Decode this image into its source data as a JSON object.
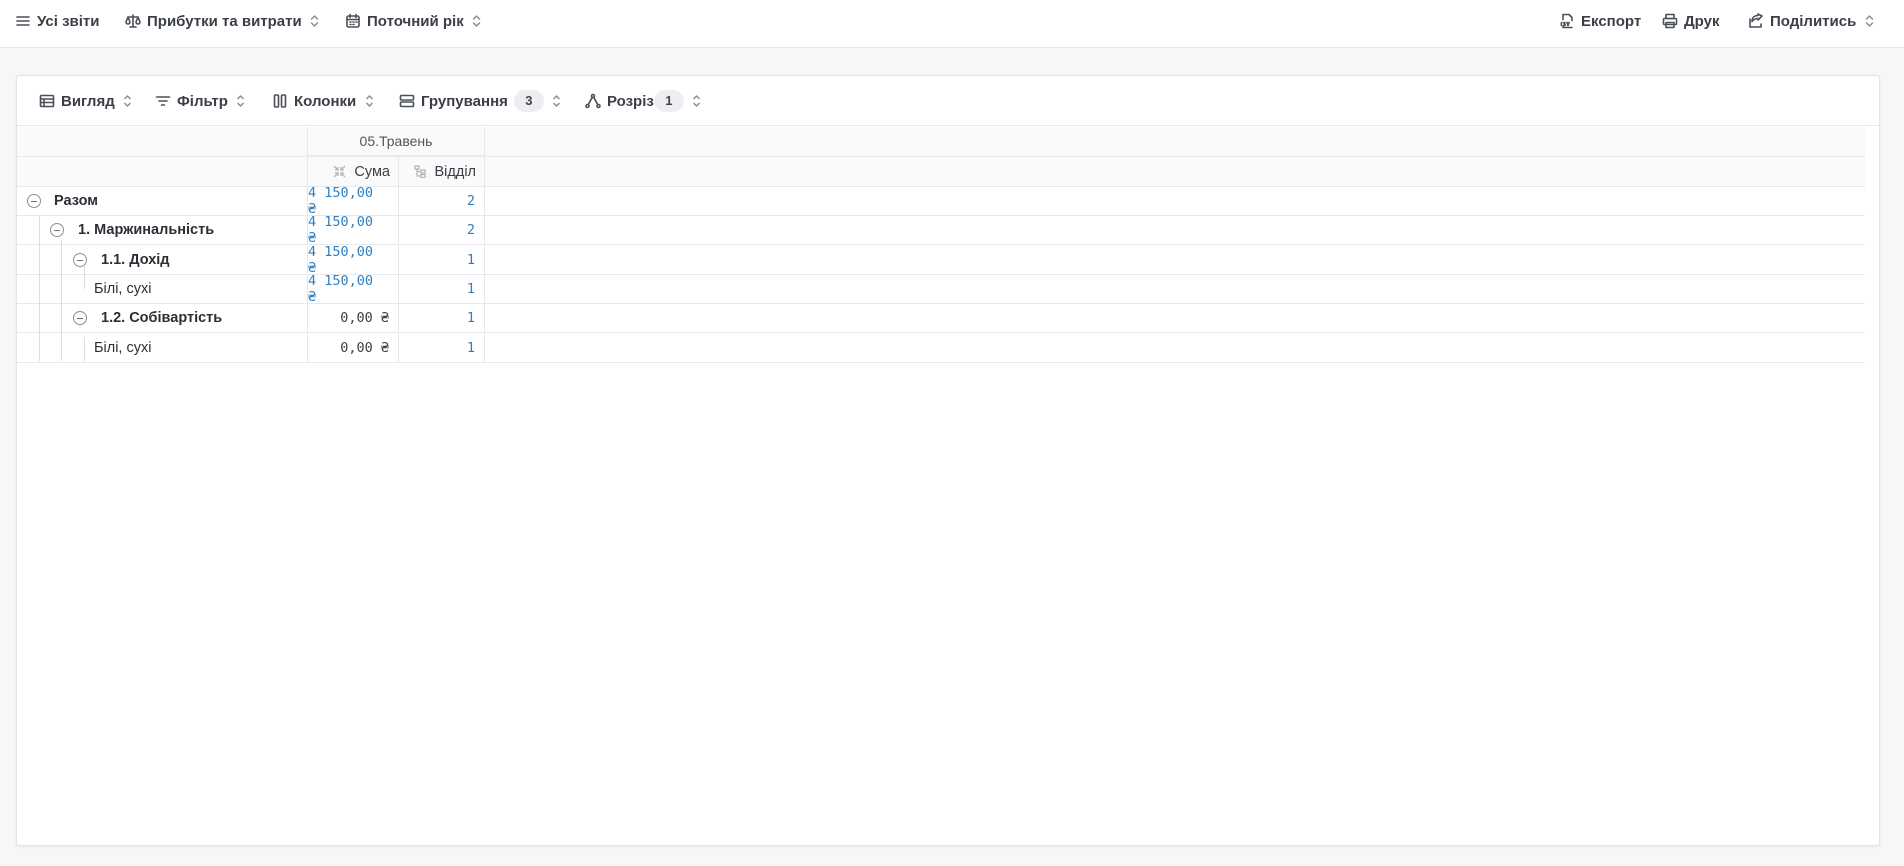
{
  "topbar": {
    "all_reports": "Усі звіти",
    "report_name": "Прибутки та витрати",
    "period": "Поточний рік",
    "export": "Експорт",
    "print": "Друк",
    "share": "Поділитись"
  },
  "toolbar": {
    "view": "Вигляд",
    "filter": "Фільтр",
    "columns": "Колонки",
    "grouping": "Групування",
    "grouping_count": "3",
    "slice": "Розріз",
    "slice_count": "1"
  },
  "table": {
    "period_header": "05.Травень",
    "col_sum": "Сума",
    "col_dept": "Відділ",
    "rows": [
      {
        "label": "Разом",
        "sum": "4 150,00 ₴",
        "dept": "2"
      },
      {
        "label": "1. Маржинальність",
        "sum": "4 150,00 ₴",
        "dept": "2"
      },
      {
        "label": "1.1. Дохід",
        "sum": "4 150,00 ₴",
        "dept": "1"
      },
      {
        "label": "Білі, сухі",
        "sum": "4 150,00 ₴",
        "dept": "1"
      },
      {
        "label": "1.2. Собівартість",
        "sum": "0,00 ₴",
        "dept": "1"
      },
      {
        "label": "Білі, сухі",
        "sum": "0,00 ₴",
        "dept": "1"
      }
    ]
  },
  "colors": {
    "accent_blue": "#2f7fc1",
    "background": "#f6f7f9"
  }
}
